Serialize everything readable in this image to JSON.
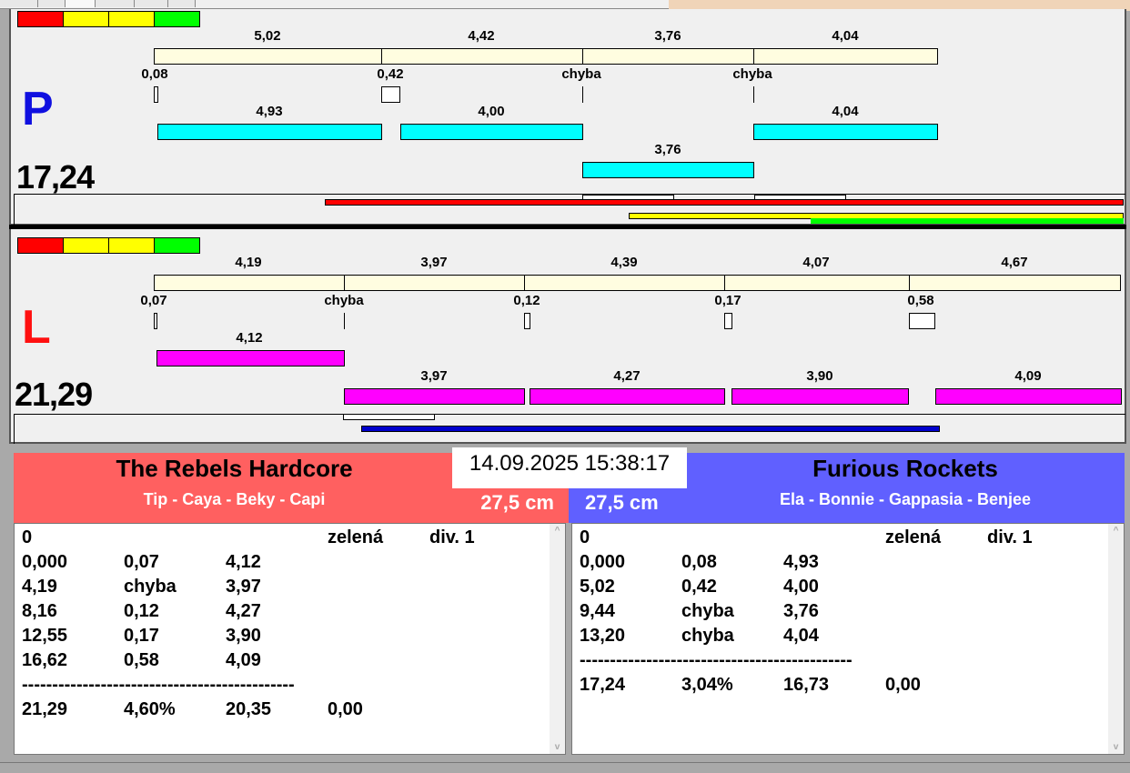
{
  "lanes": {
    "P": {
      "letter": "P",
      "letter_color": "#1010e0",
      "total": "17,24",
      "splits": [
        "5,02",
        "4,42",
        "3,76",
        "4,04"
      ],
      "reactions": [
        "0,08",
        "0,42",
        "chyba",
        "chyba"
      ],
      "runs": [
        "4,93",
        "4,00",
        "4,04",
        "3,76"
      ]
    },
    "L": {
      "letter": "L",
      "letter_color": "#ff1010",
      "total": "21,29",
      "splits": [
        "4,19",
        "3,97",
        "4,39",
        "4,07",
        "4,67"
      ],
      "reactions": [
        "0,07",
        "chyba",
        "0,12",
        "0,17",
        "0,58"
      ],
      "runs": [
        "4,12",
        "3,97",
        "4,27",
        "3,90",
        "4,09"
      ]
    }
  },
  "datetime": "14.09.2025 15:38:17",
  "teams": {
    "left": {
      "name": "The Rebels Hardcore",
      "members": "Tip - Caya - Beky - Capi",
      "height": "27,5 cm",
      "color": "#ff6060",
      "rows": [
        [
          "0",
          "",
          "",
          "zelená",
          "div. 1"
        ],
        [
          "0,000",
          "0,07",
          "4,12"
        ],
        [
          "4,19",
          "chyba",
          "3,97"
        ],
        [
          "8,16",
          "0,12",
          "4,27"
        ],
        [
          "12,55",
          "0,17",
          "3,90"
        ],
        [
          "16,62",
          "0,58",
          "4,09"
        ],
        [
          "---------------------------------------------"
        ],
        [
          "21,29",
          "4,60%",
          "20,35",
          "0,00"
        ]
      ]
    },
    "right": {
      "name": "Furious Rockets",
      "members": "Ela - Bonnie - Gappasia - Benjee",
      "height": "27,5 cm",
      "color": "#6060ff",
      "rows": [
        [
          "0",
          "",
          "",
          "zelená",
          "div. 1"
        ],
        [
          "0,000",
          "0,08",
          "4,93"
        ],
        [
          "5,02",
          "0,42",
          "4,00"
        ],
        [
          "9,44",
          "chyba",
          "3,76"
        ],
        [
          "13,20",
          "chyba",
          "4,04"
        ],
        [
          "---------------------------------------------"
        ],
        [
          "17,24",
          "3,04%",
          "16,73",
          "0,00"
        ]
      ]
    }
  },
  "colors": {
    "red": "#ff0000",
    "yellow": "#ffff00",
    "green": "#00ff00",
    "blue": "#0000cc"
  }
}
